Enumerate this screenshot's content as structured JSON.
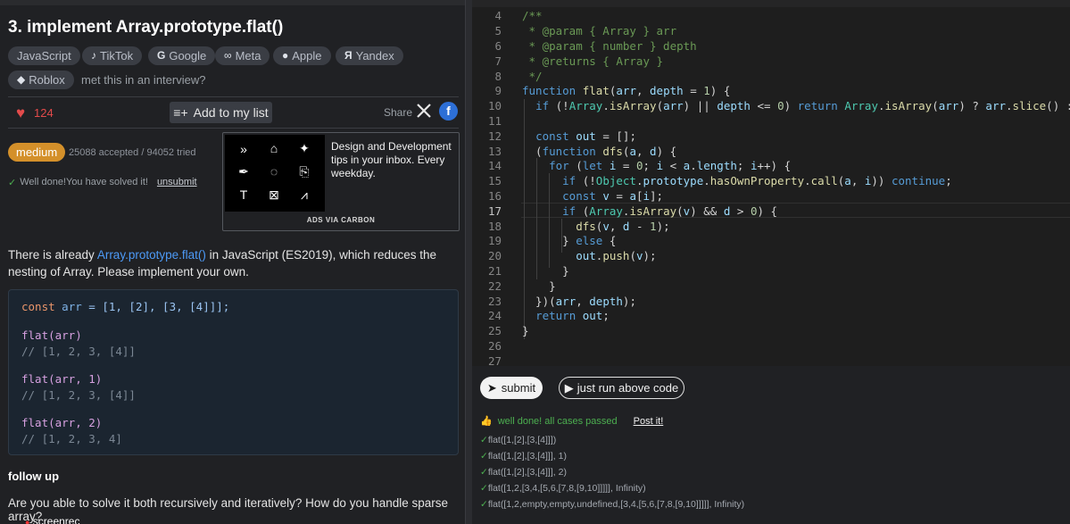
{
  "problem": {
    "title": "3. implement Array.prototype.flat()",
    "tags": [
      {
        "label": "JavaScript",
        "icon": ""
      },
      {
        "label": "TikTok",
        "icon": "tiktok-icon"
      },
      {
        "label": "Google",
        "icon": "google-icon"
      },
      {
        "label": "Meta",
        "icon": "meta-icon"
      },
      {
        "label": "Apple",
        "icon": "apple-icon"
      },
      {
        "label": "Yandex",
        "icon": "yandex-icon"
      },
      {
        "label": "Roblox",
        "icon": "roblox-icon"
      }
    ],
    "met_in_interview": "met this in an interview?",
    "likes": "124",
    "add_to_list": "Add to my list",
    "share": "Share",
    "difficulty": "medium",
    "stats": "25088 accepted / 94052 tried",
    "solved_text": "Well done!You have solved it!",
    "unsubmit": "unsubmit",
    "description_pre": "There is already ",
    "description_link": "Array.prototype.flat()",
    "description_post": " in JavaScript (ES2019), which reduces the nesting of Array. Please implement your own.",
    "followup_title": "follow up",
    "followup_question": "Are you able to solve it both recursively and iteratively? How do you handle sparse array?"
  },
  "ad": {
    "text": "Design and Development tips in your inbox. Every weekday.",
    "via": "ADS VIA CARBON"
  },
  "example": {
    "line1": {
      "kw": "const",
      "var": "arr",
      "rest": " = [1, [2], [3, [4]]];"
    },
    "calls": [
      {
        "call": "flat(arr)",
        "result": "// [1, 2, 3, [4]]"
      },
      {
        "call": "flat(arr, 1)",
        "result": "// [1, 2, 3, [4]]"
      },
      {
        "call": "flat(arr, 2)",
        "result": "// [1, 2, 3, 4]"
      }
    ]
  },
  "editor": {
    "active_line": 17,
    "line_numbers": [
      "4",
      "5",
      "6",
      "7",
      "8",
      "9",
      "10",
      "11",
      "12",
      "13",
      "14",
      "15",
      "16",
      "17",
      "18",
      "19",
      "20",
      "21",
      "22",
      "23",
      "24",
      "25",
      "26",
      "27"
    ]
  },
  "results": {
    "submit": "submit",
    "run": "just run above code",
    "passed": "well done! all cases passed",
    "post": "Post it!",
    "cases": [
      "flat([1,[2],[3,[4]]])",
      "flat([1,[2],[3,[4]]], 1)",
      "flat([1,[2],[3,[4]]], 2)",
      "flat([1,2,[3,4,[5,6,[7,8,[9,10]]]]], Infinity)",
      "flat([1,2,empty,empty,undefined,[3,4,[5,6,[7,8,[9,10]]]]], Infinity)"
    ]
  },
  "watermark": "screenrec",
  "colors": {
    "accent_blue": "#4d9af7",
    "medium": "#d4902a",
    "heart": "#e34b4b",
    "pass_green": "#4caf50"
  }
}
